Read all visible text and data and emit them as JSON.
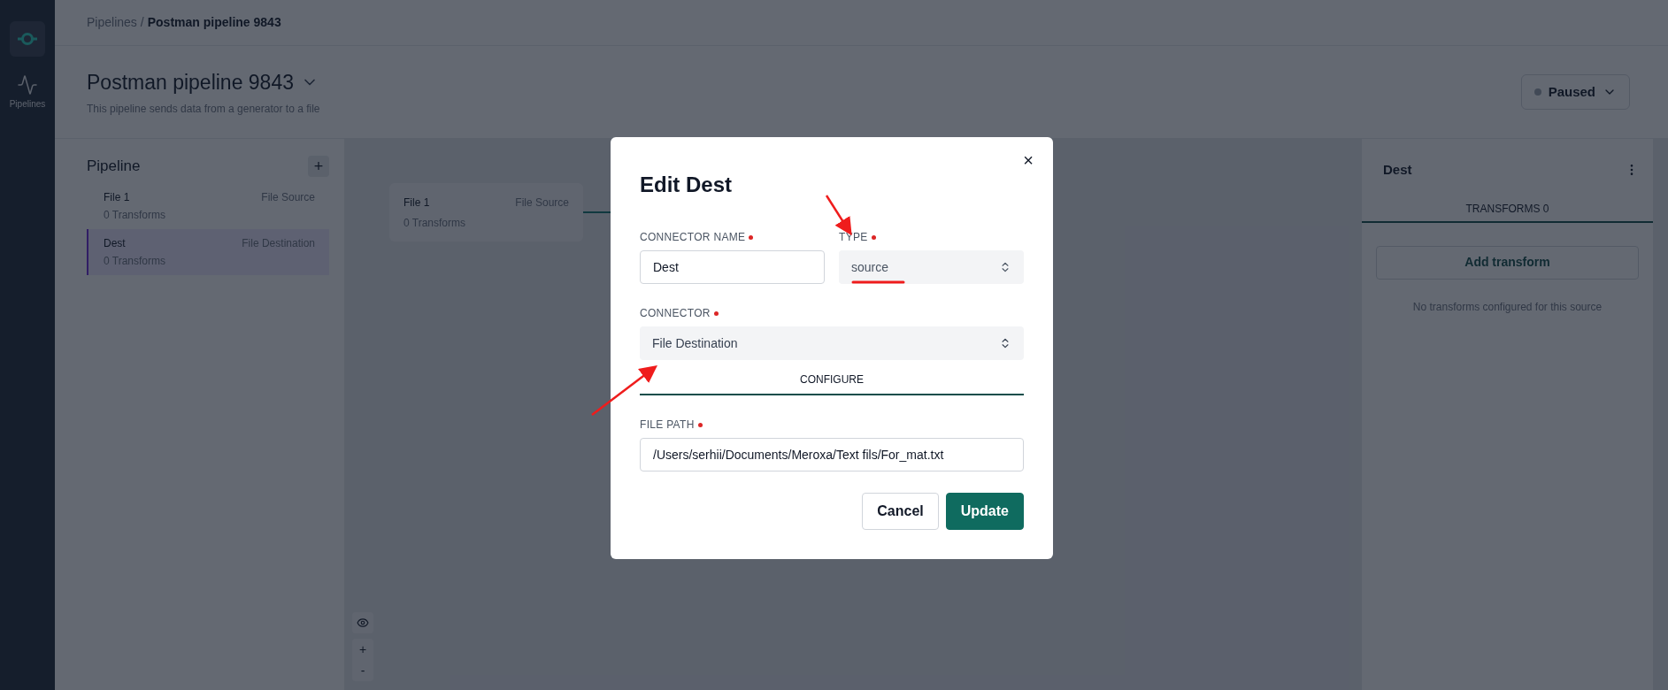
{
  "sidebar": {
    "items": [
      {
        "label": "Pipelines",
        "selected": true
      }
    ]
  },
  "breadcrumb": {
    "parent": "Pipelines",
    "separator": "/",
    "current": "Postman pipeline 9843"
  },
  "header": {
    "title": "Postman pipeline 9843",
    "description": "This pipeline sends data from a generator to a file",
    "status": {
      "label": "Paused"
    }
  },
  "pipeline_panel": {
    "title": "Pipeline",
    "add_button": "+",
    "items": [
      {
        "name": "File 1",
        "type": "File Source",
        "transforms": "0 Transforms",
        "selected": false
      },
      {
        "name": "Dest",
        "type": "File Destination",
        "transforms": "0 Transforms",
        "selected": true
      }
    ]
  },
  "canvas": {
    "nodes": [
      {
        "name": "File 1",
        "type": "File Source",
        "transforms": "0 Transforms"
      }
    ],
    "zoom_in": "+",
    "zoom_out": "-"
  },
  "right_panel": {
    "title": "Dest",
    "tabs": [
      {
        "label": "TRANSFORMS 0",
        "selected": true
      }
    ],
    "add_button": "Add transform",
    "empty_text": "No transforms configured for this source"
  },
  "modal": {
    "title": "Edit Dest",
    "close": "×",
    "connector_name": {
      "label": "CONNECTOR NAME",
      "required": true,
      "value": "Dest"
    },
    "type": {
      "label": "TYPE",
      "required": true,
      "value": "source"
    },
    "connector": {
      "label": "CONNECTOR",
      "required": true,
      "value": "File Destination"
    },
    "tabs": [
      {
        "label": "CONFIGURE",
        "selected": true
      }
    ],
    "file_path": {
      "label": "FILE PATH",
      "required": true,
      "value": "/Users/serhii/Documents/Meroxa/Text fils/For_mat.txt"
    },
    "buttons": [
      {
        "label": "Cancel",
        "kind": "secondary"
      },
      {
        "label": "Update",
        "kind": "primary"
      }
    ]
  }
}
